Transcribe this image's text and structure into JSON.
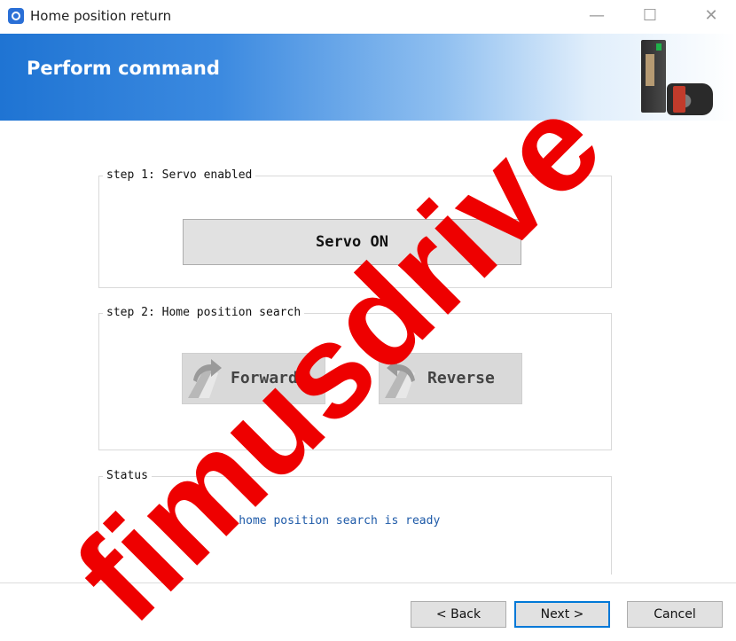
{
  "window": {
    "title": "Home position return",
    "controls": [
      "—",
      "☐",
      "✕"
    ]
  },
  "banner": {
    "title": "Perform command"
  },
  "step1": {
    "legend": "step 1: Servo enabled",
    "button_label": "Servo ON"
  },
  "step2": {
    "legend": "step 2: Home position search",
    "forward_label": "Forward",
    "reverse_label": "Reverse"
  },
  "status": {
    "legend": "Status",
    "message": "The home position search is ready"
  },
  "footer": {
    "back_label": "< Back",
    "next_label": "Next >",
    "cancel_label": "Cancel"
  },
  "watermark": {
    "text": "fimusdrive"
  },
  "colors": {
    "banner_blue": "#1f74d3",
    "status_text": "#1e5aa8",
    "watermark": "#ee0000"
  }
}
